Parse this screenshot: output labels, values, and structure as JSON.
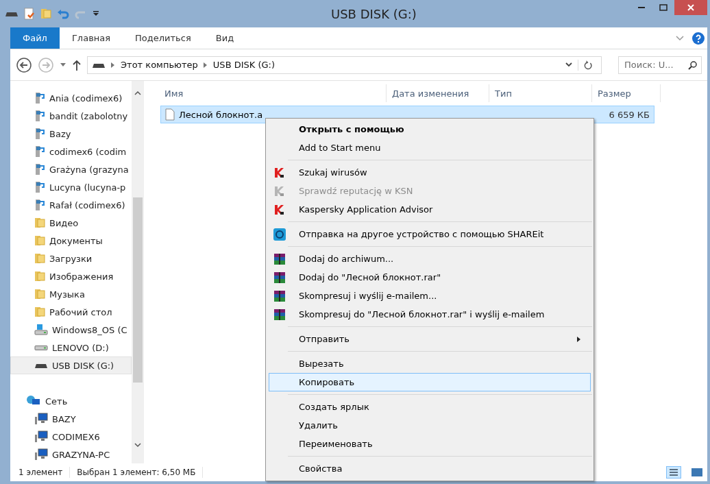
{
  "window": {
    "title": "USB DISK (G:)"
  },
  "ribbon_tabs": [
    {
      "label": "Файл",
      "selected": true
    },
    {
      "label": "Главная",
      "selected": false
    },
    {
      "label": "Поделиться",
      "selected": false
    },
    {
      "label": "Вид",
      "selected": false
    }
  ],
  "address": {
    "path": [
      "Этот компьютер",
      "USB DISK (G:)"
    ],
    "search_placeholder": "Поиск: U..."
  },
  "sidebar": {
    "items": [
      {
        "label": "Ania (codimex6)",
        "kind": "netdrive",
        "selected": false
      },
      {
        "label": "bandit (zabolotny",
        "kind": "netdrive",
        "selected": false
      },
      {
        "label": "Bazy",
        "kind": "netdrive",
        "selected": false
      },
      {
        "label": "codimex6 (codim",
        "kind": "netdrive",
        "selected": false
      },
      {
        "label": "Grażyna (grazyna",
        "kind": "netdrive",
        "selected": false
      },
      {
        "label": "Lucyna (lucyna-p",
        "kind": "netdrive",
        "selected": false
      },
      {
        "label": "Rafał (codimex6)",
        "kind": "netdrive",
        "selected": false
      },
      {
        "label": "Видео",
        "kind": "folder",
        "selected": false
      },
      {
        "label": "Документы",
        "kind": "folder",
        "selected": false
      },
      {
        "label": "Загрузки",
        "kind": "folder",
        "selected": false
      },
      {
        "label": "Изображения",
        "kind": "folder",
        "selected": false
      },
      {
        "label": "Музыка",
        "kind": "folder",
        "selected": false
      },
      {
        "label": "Рабочий стол",
        "kind": "folder",
        "selected": false
      },
      {
        "label": "Windows8_OS (C",
        "kind": "system",
        "selected": false
      },
      {
        "label": "LENOVO (D:)",
        "kind": "drive",
        "selected": false
      },
      {
        "label": "USB DISK (G:)",
        "kind": "usb",
        "selected": true
      },
      {
        "label": "Сеть",
        "kind": "network",
        "selected": false
      },
      {
        "label": "BAZY",
        "kind": "computer",
        "selected": false
      },
      {
        "label": "CODIMEX6",
        "kind": "computer",
        "selected": false
      },
      {
        "label": "GRAZYNA-PC",
        "kind": "computer",
        "selected": false
      }
    ]
  },
  "table": {
    "columns": [
      "Имя",
      "Дата изменения",
      "Тип",
      "Размер"
    ],
    "rows": [
      {
        "name": "Лесной блокнот.a",
        "size": "6 659 КБ",
        "selected": true
      }
    ]
  },
  "context_menu": {
    "groups": [
      {
        "items": [
          {
            "label": "Открыть с помощью",
            "kind": "plain",
            "default": true,
            "disabled": false,
            "selected": false,
            "submenu": false
          },
          {
            "label": "Add to Start menu",
            "kind": "plain",
            "default": false,
            "disabled": false,
            "selected": false,
            "submenu": false
          }
        ]
      },
      {
        "items": [
          {
            "label": "Szukaj wirusów",
            "kind": "antivirus",
            "default": false,
            "disabled": false,
            "selected": false,
            "submenu": false
          },
          {
            "label": "Sprawdź reputację w KSN",
            "kind": "antivirus",
            "default": false,
            "disabled": true,
            "selected": false,
            "submenu": false
          },
          {
            "label": "Kaspersky Application Advisor",
            "kind": "antivirus",
            "default": false,
            "disabled": false,
            "selected": false,
            "submenu": false
          }
        ]
      },
      {
        "items": [
          {
            "label": "Отправка на другое устройство с помощью SHAREit",
            "kind": "share",
            "default": false,
            "disabled": false,
            "selected": false,
            "submenu": false
          }
        ]
      },
      {
        "items": [
          {
            "label": "Dodaj do archiwum...",
            "kind": "archive",
            "default": false,
            "disabled": false,
            "selected": false,
            "submenu": false
          },
          {
            "label": "Dodaj do \"Лесной блокнот.rar\"",
            "kind": "archive",
            "default": false,
            "disabled": false,
            "selected": false,
            "submenu": false
          },
          {
            "label": "Skompresuj i wyślij e-mailem...",
            "kind": "archive",
            "default": false,
            "disabled": false,
            "selected": false,
            "submenu": false
          },
          {
            "label": "Skompresuj do \"Лесной блокнот.rar\" i wyślij e-mailem",
            "kind": "archive",
            "default": false,
            "disabled": false,
            "selected": false,
            "submenu": false
          }
        ]
      },
      {
        "items": [
          {
            "label": "Отправить",
            "kind": "plain",
            "default": false,
            "disabled": false,
            "selected": false,
            "submenu": true
          }
        ]
      },
      {
        "items": [
          {
            "label": "Вырезать",
            "kind": "plain",
            "default": false,
            "disabled": false,
            "selected": false,
            "submenu": false
          },
          {
            "label": "Копировать",
            "kind": "plain",
            "default": false,
            "disabled": false,
            "selected": true,
            "submenu": false
          }
        ]
      },
      {
        "items": [
          {
            "label": "Создать ярлык",
            "kind": "plain",
            "default": false,
            "disabled": false,
            "selected": false,
            "submenu": false
          },
          {
            "label": "Удалить",
            "kind": "plain",
            "default": false,
            "disabled": false,
            "selected": false,
            "submenu": false
          },
          {
            "label": "Переименовать",
            "kind": "plain",
            "default": false,
            "disabled": false,
            "selected": false,
            "submenu": false
          }
        ]
      },
      {
        "items": [
          {
            "label": "Свойства",
            "kind": "plain",
            "default": false,
            "disabled": false,
            "selected": false,
            "submenu": false
          }
        ]
      }
    ]
  },
  "status_bar": {
    "count": "1 элемент",
    "selection": "Выбран 1 элемент: 6,50 МБ"
  }
}
